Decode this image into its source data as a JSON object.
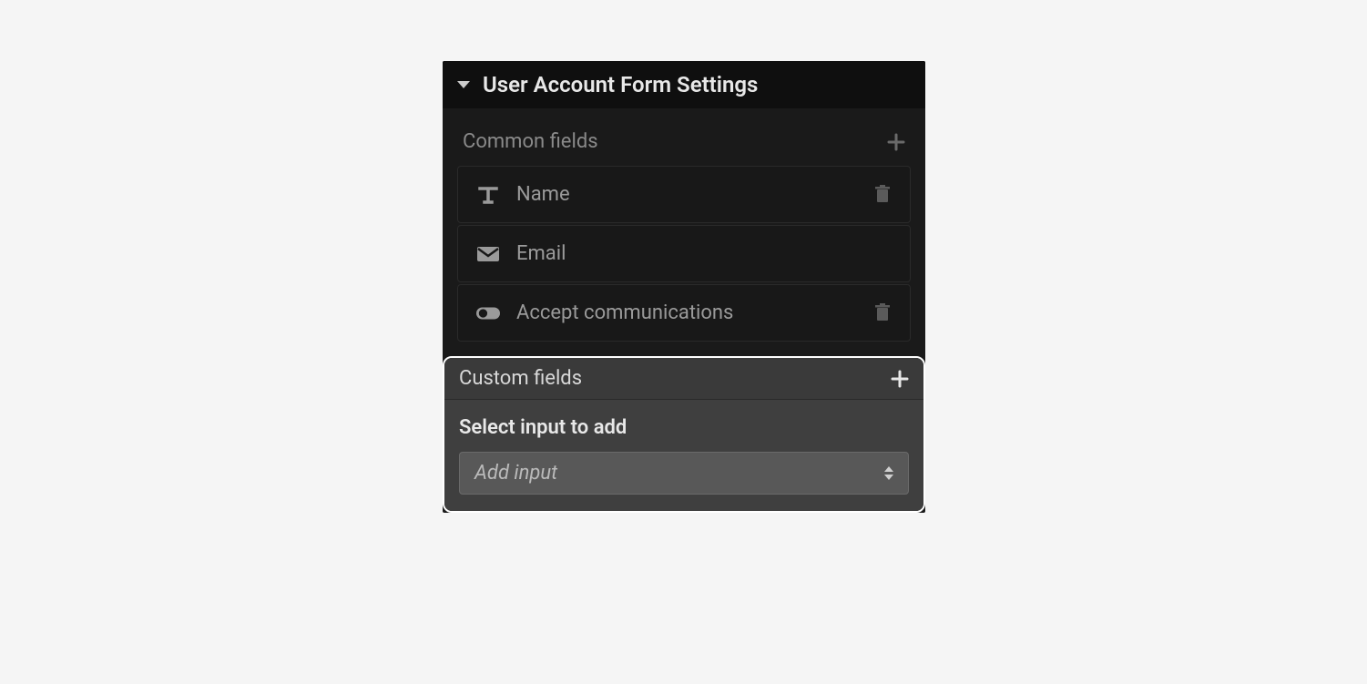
{
  "panel": {
    "title": "User Account Form Settings"
  },
  "common": {
    "title": "Common fields",
    "fields": [
      {
        "label": "Name",
        "icon": "text",
        "deletable": true
      },
      {
        "label": "Email",
        "icon": "mail",
        "deletable": false
      },
      {
        "label": "Accept communications",
        "icon": "toggle",
        "deletable": true
      }
    ]
  },
  "custom": {
    "title": "Custom fields",
    "select_label": "Select input to add",
    "select_placeholder": "Add input"
  }
}
